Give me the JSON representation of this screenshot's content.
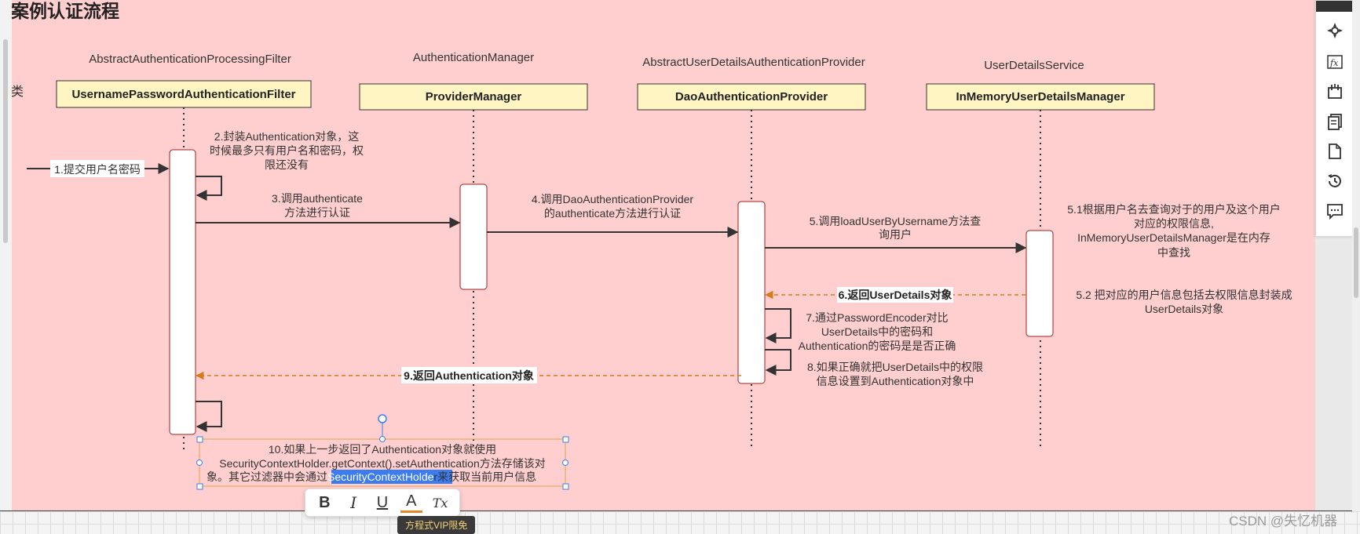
{
  "page": {
    "title": "案例认证流程",
    "side_fragment": "类"
  },
  "lifelines": [
    {
      "superclass": "AbstractAuthenticationProcessingFilter",
      "name": "UsernamePasswordAuthenticationFilter"
    },
    {
      "superclass": "AuthenticationManager",
      "name": "ProviderManager"
    },
    {
      "superclass": "AbstractUserDetailsAuthenticationProvider",
      "name": "DaoAuthenticationProvider"
    },
    {
      "superclass": "UserDetailsService",
      "name": "InMemoryUserDetailsManager"
    }
  ],
  "messages": {
    "m1": "1.提交用户名密码",
    "m2": [
      "2.封装Authentication对象，这",
      "时候最多只有用户名和密码，权",
      "限还没有"
    ],
    "m3": [
      "3.调用authenticate",
      "方法进行认证"
    ],
    "m4": [
      "4.调用DaoAuthenticationProvider",
      "的authenticate方法进行认证"
    ],
    "m5": [
      "5.调用loadUserByUsername方法查",
      "询用户"
    ],
    "m51": [
      "5.1根据用户名去查询对于的用户及这个用户",
      "对应的权限信息,",
      "InMemoryUserDetailsManager是在内存",
      "中查找"
    ],
    "m52": [
      "5.2 把对应的用户信息包括去权限信息封装成",
      "UserDetails对象"
    ],
    "m6": "6.返回UserDetails对象",
    "m7": [
      "7.通过PasswordEncoder对比",
      "UserDetails中的密码和",
      "Authentication的密码是是否正确"
    ],
    "m8": [
      "8.如果正确就把UserDetails中的权限",
      "信息设置到Authentication对象中"
    ],
    "m9": "9.返回Authentication对象",
    "m10_line1": "10.如果上一步返回了Authentication对象就使用",
    "m10_line2": "SecurityContextHolder.getContext().setAuthentication方法存储该对",
    "m10_line3_pre": "象。其它过滤器中会通过",
    "m10_line3_sel": "SecurityContextHolde",
    "m10_line3_post": "r来获取当前用户信息"
  },
  "toolbar": {
    "icons": [
      "navigate-icon",
      "formula-icon",
      "insert-shape-icon",
      "pages-icon",
      "document-icon",
      "history-icon",
      "comment-icon"
    ]
  },
  "format_bar": {
    "bold": "B",
    "italic": "I",
    "underline": "U",
    "font_color": "A",
    "clear_format": "Tx",
    "vip_tag": "方程式VIP限免"
  },
  "watermark": "CSDN @失忆机器",
  "colors": {
    "canvas_bg": "#ffcfcf",
    "box_fill": "#fff5c2",
    "return_arrow": "#d97b1a",
    "selection": "#3b7df0"
  }
}
